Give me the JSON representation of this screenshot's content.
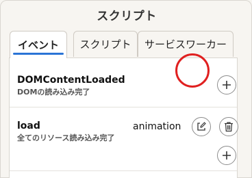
{
  "panel": {
    "title": "スクリプト"
  },
  "tabs": [
    {
      "label": "イベント",
      "active": true
    },
    {
      "label": "スクリプト",
      "active": false
    },
    {
      "label": "サービスワーカー",
      "active": false
    }
  ],
  "events": [
    {
      "name": "DOMContentLoaded",
      "description": "DOMの読み込み完了",
      "handler": ""
    },
    {
      "name": "load",
      "description": "全てのリソース読み込み完了",
      "handler": "animation"
    }
  ],
  "icons": {
    "add": "plus-icon",
    "edit": "pencil-square-icon",
    "delete": "trash-icon"
  },
  "colors": {
    "accent": "#2b74d6",
    "highlight": "#e02020"
  }
}
